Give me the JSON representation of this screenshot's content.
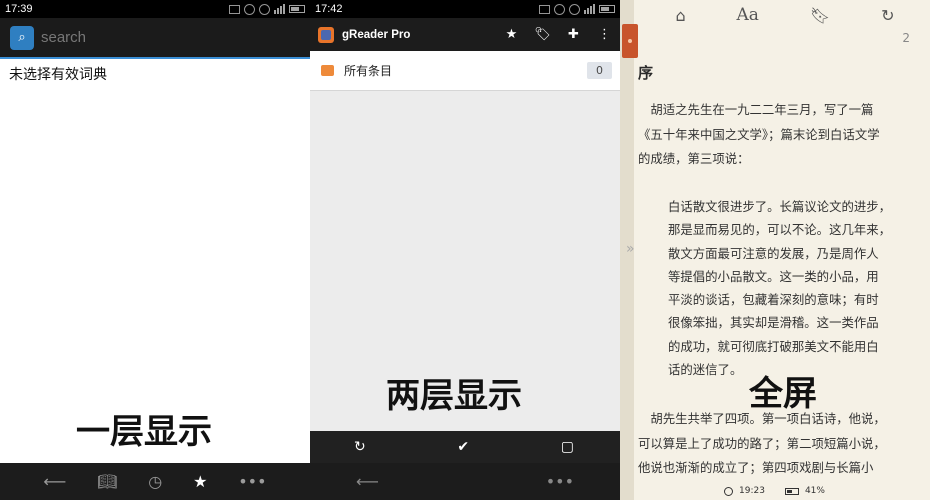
{
  "panel1": {
    "status_time": "17:39",
    "search_placeholder": "search",
    "message": "未选择有效词典",
    "caption": "一层显示",
    "nav_icons": [
      "back-arrow-icon",
      "book-icon",
      "clock-icon",
      "star-icon",
      "more-icon"
    ]
  },
  "panel2": {
    "status_time": "17:42",
    "app_title": "gReader Pro",
    "toolbar_icons": [
      "star-icon",
      "tag-icon",
      "plus-icon",
      "overflow-menu-icon"
    ],
    "row_label": "所有条目",
    "row_count": "0",
    "caption": "两层显示",
    "action_icons": [
      "refresh-icon",
      "check-icon",
      "square-icon"
    ],
    "nav_icons": [
      "back-arrow-icon",
      "more-icon"
    ]
  },
  "panel3": {
    "toolbar_icons": [
      "home-icon",
      "font-size-icon",
      "bookmark-icon",
      "refresh-icon"
    ],
    "font_button": "Aa",
    "page_number": "2",
    "heading": "序",
    "para1": "　胡适之先生在一九二二年三月，写了一篇\n《五十年来中国之文学》；篇末论到白话文学\n的成绩，第三项说：",
    "quote": "白话散文很进步了。长篇议论文的进步，\n那是显而易见的，可以不论。这几年来，\n散文方面最可注意的发展，乃是周作人\n等提倡的小品散文。这一类的小品，用\n平淡的谈话，包藏着深刻的意味；有时\n很像笨拙，其实却是滑稽。这一类作品\n的成功，就可彻底打破那美文不能用白\n话的迷信了。",
    "para2": "　胡先生共举了四项。第一项白话诗，他说，\n可以算是上了成功的路了；第二项短篇小说，\n他说也渐渐的成立了；第四项戏剧与长篇小",
    "caption": "全屏",
    "clock_time": "19:23",
    "battery": "41%"
  }
}
